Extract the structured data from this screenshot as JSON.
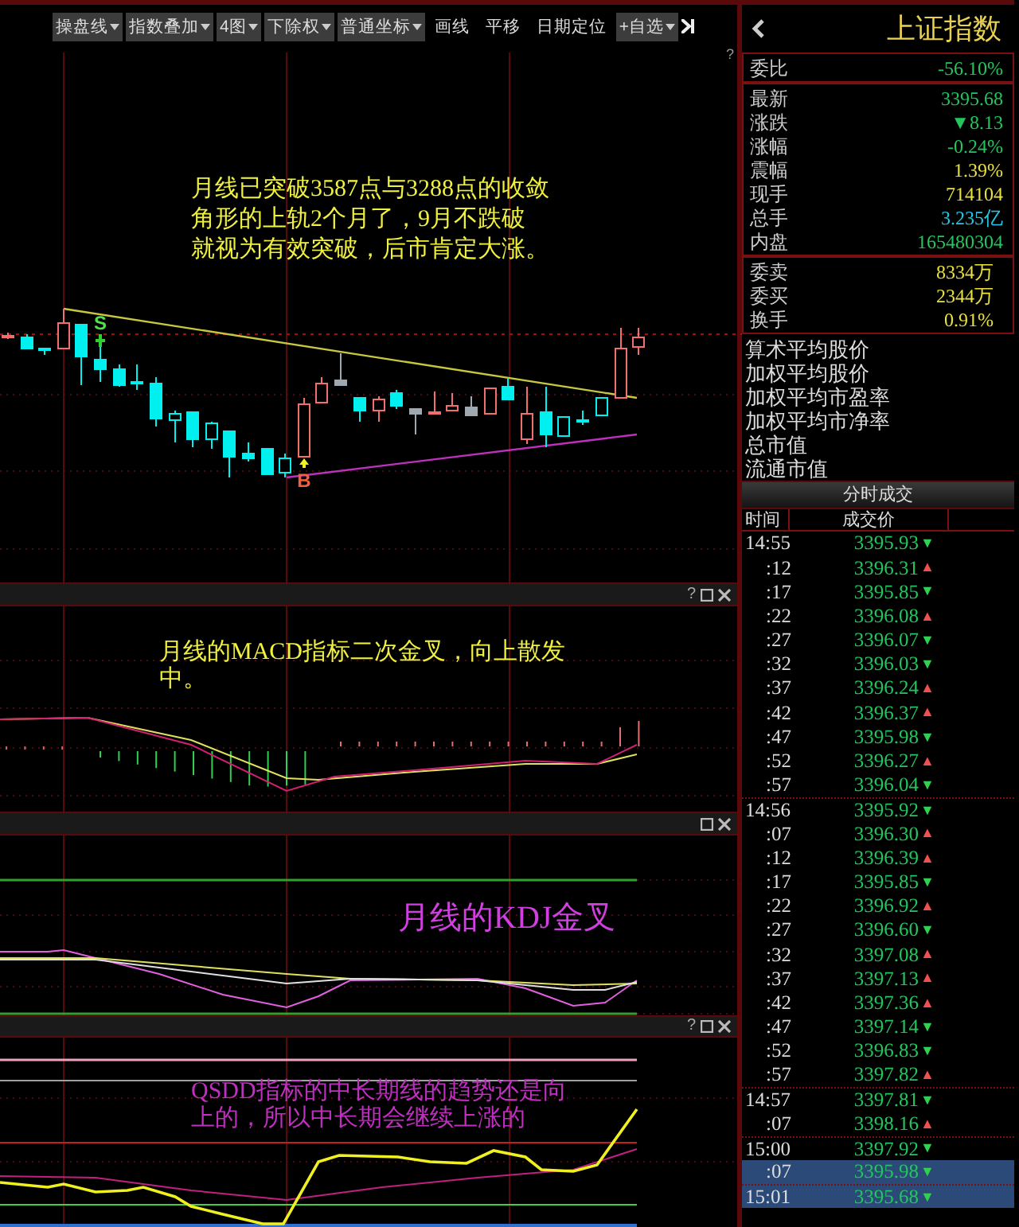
{
  "toolbar": {
    "items": [
      {
        "label": "操盘线",
        "dropdown": true
      },
      {
        "label": "指数叠加",
        "dropdown": true
      },
      {
        "label": "4图",
        "dropdown": true
      },
      {
        "label": "下除权",
        "dropdown": true
      },
      {
        "label": "普通坐标",
        "dropdown": true
      },
      {
        "label": "画线",
        "dropdown": false
      },
      {
        "label": "平移",
        "dropdown": false
      },
      {
        "label": "日期定位",
        "dropdown": false
      },
      {
        "label": "+自选",
        "dropdown": true
      }
    ]
  },
  "main_chart": {
    "help": "?",
    "signals": [
      {
        "label": "S",
        "kind": "sell"
      },
      {
        "label": "B",
        "kind": "buy"
      }
    ],
    "annotation": [
      "月线已突破3587点与3288点的收敛",
      "角形的上轨2个月了，9月不跌破",
      "就视为有效突破，后市肯定大涨。"
    ]
  },
  "indicator_panels": [
    {
      "kind": "macd",
      "help": "?",
      "annotation": [
        "月线的MACD指标二次金叉，向上散发",
        "中。"
      ]
    },
    {
      "kind": "kdj",
      "annotation": [
        "月线的KDJ金叉"
      ]
    },
    {
      "kind": "qsdd",
      "help": "?",
      "annotation": [
        "QSDD指标的中长期线的趋势还是向",
        "上的，所以中长期会继续上涨的"
      ]
    }
  ],
  "quote_panel": {
    "title": "上证指数",
    "sections": [
      [
        {
          "label": "委比",
          "value": "-56.10%",
          "color": "#22c55e"
        }
      ],
      [
        {
          "label": "最新",
          "value": "3395.68",
          "color": "#22c55e"
        },
        {
          "label": "涨跌",
          "value": "▼8.13",
          "color": "#22c55e"
        },
        {
          "label": "涨幅",
          "value": "-0.24%",
          "color": "#22c55e"
        },
        {
          "label": "震幅",
          "value": "1.39%",
          "color": "#e8e040"
        },
        {
          "label": "现手",
          "value": "714104",
          "color": "#e8e040"
        },
        {
          "label": "总手",
          "value": "3.235亿",
          "color": "#22c8e8"
        },
        {
          "label": "内盘",
          "value": "165480304",
          "color": "#22c55e"
        }
      ],
      [
        {
          "label": "委卖",
          "value": "8334万",
          "color": "#e8e040"
        },
        {
          "label": "委买",
          "value": "2344万",
          "color": "#e8e040"
        },
        {
          "label": "换手",
          "value": "0.91%",
          "color": "#e8e040"
        }
      ]
    ],
    "info_labels": [
      "算术平均股价",
      "加权平均股价",
      "加权平均市盈率",
      "加权平均市净率",
      "总市值",
      "流通市值"
    ]
  },
  "trades": {
    "title": "分时成交",
    "columns": [
      "时间",
      "成交价"
    ],
    "rows": [
      {
        "time": "14:55",
        "kind": "minute",
        "price": "3395.93",
        "direction": "▼",
        "rising": false,
        "selected": false
      },
      {
        "time": ":12",
        "kind": "second",
        "price": "3396.31",
        "direction": "▲",
        "rising": true,
        "selected": false
      },
      {
        "time": ":17",
        "kind": "second",
        "price": "3395.85",
        "direction": "▼",
        "rising": false,
        "selected": false
      },
      {
        "time": ":22",
        "kind": "second",
        "price": "3396.08",
        "direction": "▲",
        "rising": true,
        "selected": false
      },
      {
        "time": ":27",
        "kind": "second",
        "price": "3396.07",
        "direction": "▼",
        "rising": false,
        "selected": false
      },
      {
        "time": ":32",
        "kind": "second",
        "price": "3396.03",
        "direction": "▼",
        "rising": false,
        "selected": false
      },
      {
        "time": ":37",
        "kind": "second",
        "price": "3396.24",
        "direction": "▲",
        "rising": true,
        "selected": false
      },
      {
        "time": ":42",
        "kind": "second",
        "price": "3396.37",
        "direction": "▲",
        "rising": true,
        "selected": false
      },
      {
        "time": ":47",
        "kind": "second",
        "price": "3395.98",
        "direction": "▼",
        "rising": false,
        "selected": false
      },
      {
        "time": ":52",
        "kind": "second",
        "price": "3396.27",
        "direction": "▲",
        "rising": true,
        "selected": false
      },
      {
        "time": ":57",
        "kind": "second",
        "price": "3396.04",
        "direction": "▼",
        "rising": false,
        "selected": false
      },
      {
        "time": "14:56",
        "kind": "minute",
        "price": "3395.92",
        "direction": "▼",
        "rising": false,
        "selected": false
      },
      {
        "time": ":07",
        "kind": "second",
        "price": "3396.30",
        "direction": "▲",
        "rising": true,
        "selected": false
      },
      {
        "time": ":12",
        "kind": "second",
        "price": "3396.39",
        "direction": "▲",
        "rising": true,
        "selected": false
      },
      {
        "time": ":17",
        "kind": "second",
        "price": "3395.85",
        "direction": "▼",
        "rising": false,
        "selected": false
      },
      {
        "time": ":22",
        "kind": "second",
        "price": "3396.92",
        "direction": "▲",
        "rising": true,
        "selected": false
      },
      {
        "time": ":27",
        "kind": "second",
        "price": "3396.60",
        "direction": "▼",
        "rising": false,
        "selected": false
      },
      {
        "time": ":32",
        "kind": "second",
        "price": "3397.08",
        "direction": "▲",
        "rising": true,
        "selected": false
      },
      {
        "time": ":37",
        "kind": "second",
        "price": "3397.13",
        "direction": "▲",
        "rising": true,
        "selected": false
      },
      {
        "time": ":42",
        "kind": "second",
        "price": "3397.36",
        "direction": "▲",
        "rising": true,
        "selected": false
      },
      {
        "time": ":47",
        "kind": "second",
        "price": "3397.14",
        "direction": "▼",
        "rising": false,
        "selected": false
      },
      {
        "time": ":52",
        "kind": "second",
        "price": "3396.83",
        "direction": "▼",
        "rising": false,
        "selected": false
      },
      {
        "time": ":57",
        "kind": "second",
        "price": "3397.82",
        "direction": "▲",
        "rising": true,
        "selected": false
      },
      {
        "time": "14:57",
        "kind": "minute",
        "price": "3397.81",
        "direction": "▼",
        "rising": false,
        "selected": false
      },
      {
        "time": ":07",
        "kind": "second",
        "price": "3398.16",
        "direction": "▲",
        "rising": true,
        "selected": false
      },
      {
        "time": "15:00",
        "kind": "minute",
        "price": "3397.92",
        "direction": "▼",
        "rising": false,
        "selected": false
      },
      {
        "time": ":07",
        "kind": "second",
        "price": "3395.98",
        "direction": "▼",
        "rising": false,
        "selected": true
      },
      {
        "time": "15:01",
        "kind": "minute",
        "price": "3395.68",
        "direction": "▼",
        "rising": false,
        "selected": true
      }
    ]
  }
}
